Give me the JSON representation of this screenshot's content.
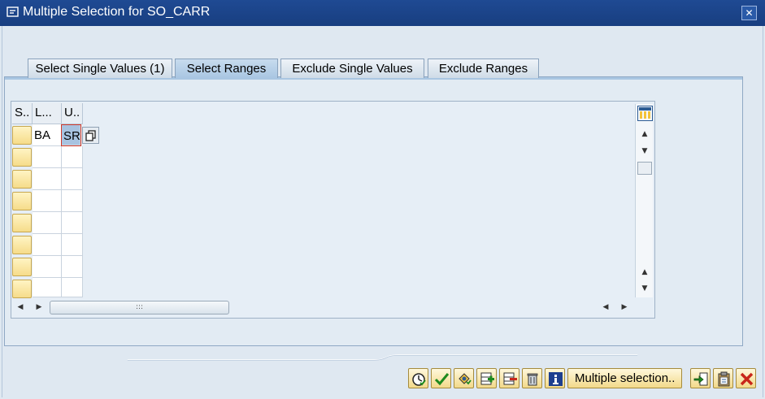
{
  "window": {
    "title": "Multiple Selection for SO_CARR",
    "close_icon": "close-icon"
  },
  "tabs": [
    {
      "label": "Select Single Values (1)",
      "active": false
    },
    {
      "label": "Select Ranges",
      "active": true
    },
    {
      "label": "Exclude Single Values",
      "active": false
    },
    {
      "label": "Exclude Ranges",
      "active": false
    }
  ],
  "table": {
    "columns": [
      "S..",
      "L...",
      "U.."
    ],
    "rows": [
      {
        "low": "BA",
        "high": "SR"
      },
      {
        "low": "",
        "high": ""
      },
      {
        "low": "",
        "high": ""
      },
      {
        "low": "",
        "high": ""
      },
      {
        "low": "",
        "high": ""
      },
      {
        "low": "",
        "high": ""
      },
      {
        "low": "",
        "high": ""
      },
      {
        "low": "",
        "high": ""
      }
    ],
    "column_settings_icon": "table-settings-icon"
  },
  "toolbar": {
    "icons": [
      "check-entries-icon",
      "copy-icon",
      "options-icon",
      "insert-row-icon",
      "delete-row-icon",
      "delete-all-icon",
      "info-icon"
    ],
    "multiple_selection_label": "Multiple selection..",
    "right_icons": [
      "import-icon",
      "upload-clipboard-icon",
      "cancel-icon"
    ]
  },
  "colors": {
    "titlebar": "#1f4a93",
    "button_face": "#f2d98a",
    "selected_cell": "#a8c3e0"
  }
}
